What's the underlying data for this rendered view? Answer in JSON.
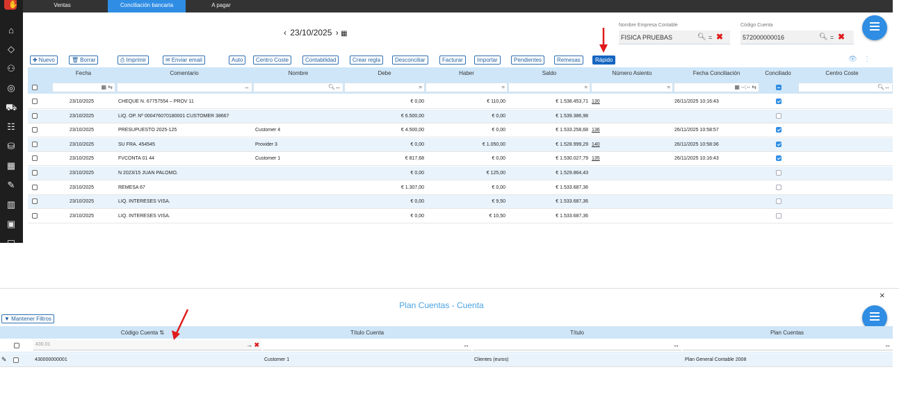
{
  "topbar": {
    "tabs": [
      {
        "label": "Ventas",
        "active": false
      },
      {
        "label": "Conciliación bancaria",
        "active": true
      },
      {
        "label": "A pagar",
        "active": false
      }
    ]
  },
  "sidebar": {
    "icons": [
      "home-icon",
      "tag-icon",
      "users-icon",
      "target-icon",
      "truck-icon",
      "group-icon",
      "coins-icon",
      "calculator-icon",
      "edit-icon",
      "chart-icon",
      "id-card-icon",
      "wallet-icon"
    ]
  },
  "date_nav": {
    "date": "23/10/2025",
    "prev": "‹",
    "next": "›",
    "calendar_icon": "calendar-icon"
  },
  "filters": {
    "empresa_label": "Nombre Empresa Contable",
    "empresa_value": "FISICA PRUEBAS",
    "cuenta_label": "Código Cuenta",
    "cuenta_value": "572000000016",
    "eq": "="
  },
  "toolbar": {
    "nuevo": "Nuevo",
    "borrar": "Borrar",
    "imprimir": "Imprimir",
    "enviar_email": "Enviar email",
    "auto": "Auto",
    "centro_coste": "Centro Coste",
    "contabilidad": "Contabilidad",
    "crear_regla": "Crear regla",
    "desconciliar": "Desconciliar",
    "facturar": "Facturar",
    "importar": "Importar",
    "pendientes": "Pendientes",
    "remesas": "Remesas",
    "rapido": "Rápido"
  },
  "grid": {
    "columns": [
      "Fecha",
      "Comentario",
      "Nombre",
      "Debe",
      "Haber",
      "Saldo",
      "Número Asiento",
      "Fecha Conciliación",
      "Conciliado",
      "Centro Coste"
    ],
    "filter_eq": "=",
    "date_placeholder": "--:--",
    "rows": [
      {
        "fecha": "23/10/2025",
        "comentario": "CHEQUE N. 67757554 – PROV 11",
        "nombre": "",
        "debe": "€ 0,00",
        "haber": "€ 110,00",
        "saldo": "€ 1.538.453,71",
        "asiento": "130",
        "fecha_conc": "26/11/2025 10:16:43",
        "conciliado": true
      },
      {
        "fecha": "23/10/2025",
        "comentario": "LIQ. OP. Nº 000476070180001 CUSTOMER 38667",
        "nombre": "",
        "debe": "€ 6.500,00",
        "haber": "€ 0,00",
        "saldo": "€ 1.539.386,98",
        "asiento": "",
        "fecha_conc": "",
        "conciliado": false
      },
      {
        "fecha": "23/10/2025",
        "comentario": "PRESUPUESTO 2025-125",
        "nombre": "Customer 4",
        "debe": "€ 4.500,00",
        "haber": "€ 0,00",
        "saldo": "€ 1.533.258,68",
        "asiento": "136",
        "fecha_conc": "26/11/2025 10:58:57",
        "conciliado": true
      },
      {
        "fecha": "23/10/2025",
        "comentario": "SU FRA. 454545",
        "nombre": "Provider 3",
        "debe": "€ 0,00",
        "haber": "€ 1.050,00",
        "saldo": "€ 1.528.999,29",
        "asiento": "140",
        "fecha_conc": "26/11/2025 10:58:36",
        "conciliado": true
      },
      {
        "fecha": "23/10/2025",
        "comentario": "FVCONTA 01 44",
        "nombre": "Customer 1",
        "debe": "€ 817,68",
        "haber": "€ 0,00",
        "saldo": "€ 1.530.027,79",
        "asiento": "135",
        "fecha_conc": "26/11/2025 10:16:43",
        "conciliado": true
      },
      {
        "fecha": "23/10/2025",
        "comentario": "N 2023/15 JUAN PALOMO.",
        "nombre": "",
        "debe": "€ 0,00",
        "haber": "€ 125,00",
        "saldo": "€ 1.529.864,43",
        "asiento": "",
        "fecha_conc": "",
        "conciliado": false
      },
      {
        "fecha": "23/10/2025",
        "comentario": "REMESA 67",
        "nombre": "",
        "debe": "€ 1.307,00",
        "haber": "€ 0,00",
        "saldo": "€ 1.533.687,36",
        "asiento": "",
        "fecha_conc": "",
        "conciliado": false
      },
      {
        "fecha": "23/10/2025",
        "comentario": "LIQ. INTERESES VISA.",
        "nombre": "",
        "debe": "€ 0,00",
        "haber": "€ 9,50",
        "saldo": "€ 1.533.687,36",
        "asiento": "",
        "fecha_conc": "",
        "conciliado": false
      },
      {
        "fecha": "23/10/2025",
        "comentario": "LIQ. INTERESES VISA.",
        "nombre": "",
        "debe": "€ 0,00",
        "haber": "€ 10,50",
        "saldo": "€ 1.533.687,36",
        "asiento": "",
        "fecha_conc": "",
        "conciliado": false
      }
    ]
  },
  "panel": {
    "title": "Plan Cuentas - Cuenta",
    "mantener_filtros": "Mantener Filtros",
    "columns": [
      "Código Cuenta",
      "Título Cuenta",
      "Título",
      "Plan Cuentas"
    ],
    "filter_value": "430.01",
    "row": {
      "codigo": "430000000001",
      "titulo_cuenta": "Customer 1",
      "titulo": "Clientes (euros)",
      "plan": "Plan General Contable 2008"
    }
  },
  "colors": {
    "accent": "#2f8de4",
    "header_bg": "#cfe6f8",
    "arrow": "#e01b1b"
  }
}
